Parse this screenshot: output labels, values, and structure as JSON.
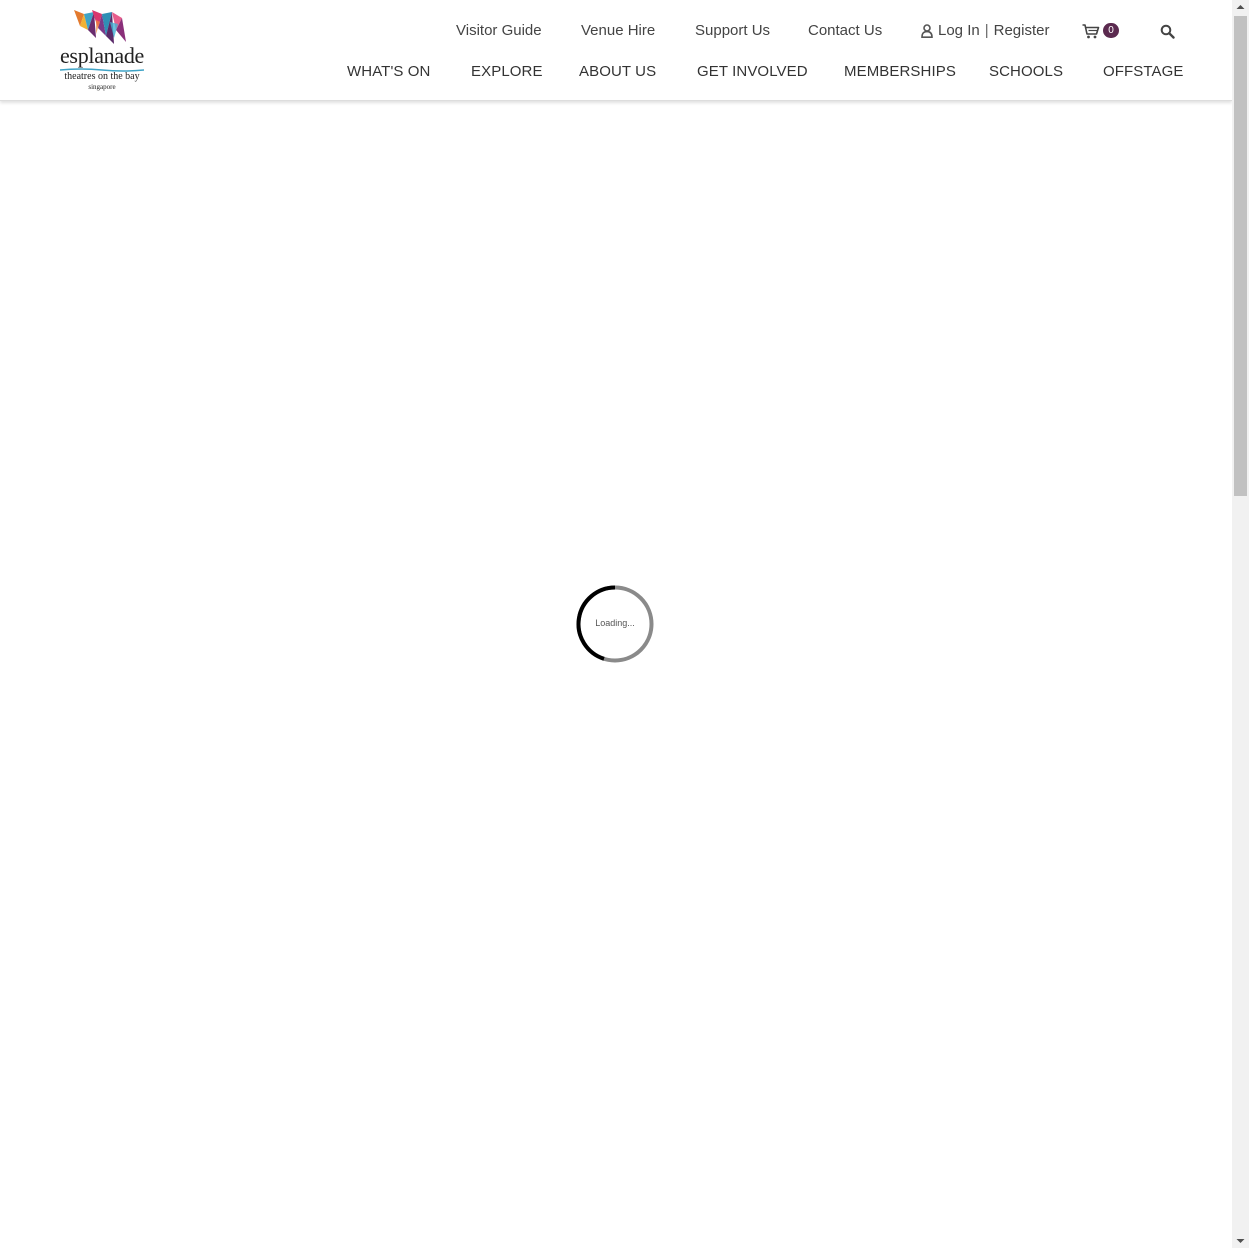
{
  "logo": {
    "wordmark": "esplanade",
    "tagline": "theatres on the bay",
    "city": "singapore"
  },
  "utility_nav": {
    "visitor_guide": "Visitor Guide",
    "venue_hire": "Venue Hire",
    "support_us": "Support Us",
    "contact_us": "Contact Us",
    "login": "Log In",
    "separator": "|",
    "register": "Register",
    "cart_count": "0",
    "cart_icon": "cart-icon",
    "search_icon": "search-icon",
    "user_icon": "user-icon"
  },
  "main_nav": {
    "whats_on": "WHAT'S ON",
    "explore": "EXPLORE",
    "about_us": "ABOUT US",
    "get_involved": "GET INVOLVED",
    "memberships": "MEMBERSHIPS",
    "schools": "SCHOOLS",
    "offstage": "OFFSTAGE"
  },
  "loader": {
    "text": "Loading..."
  },
  "colors": {
    "badge": "#5b2a4f",
    "text": "#444444"
  }
}
